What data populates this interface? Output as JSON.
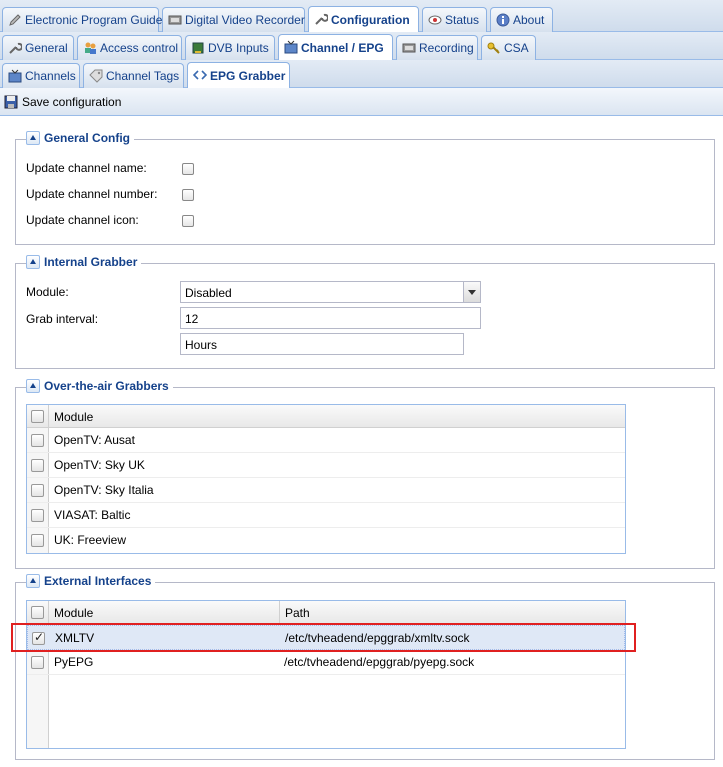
{
  "tabs_main": [
    {
      "label": "Electronic Program Guide",
      "icon": "pencil-icon"
    },
    {
      "label": "Digital Video Recorder",
      "icon": "film-icon"
    },
    {
      "label": "Configuration",
      "icon": "wrench-icon"
    },
    {
      "label": "Status",
      "icon": "eye-icon"
    },
    {
      "label": "About",
      "icon": "info-icon"
    }
  ],
  "tabs_config": [
    {
      "label": "General",
      "icon": "wrench-icon"
    },
    {
      "label": "Access control",
      "icon": "users-icon"
    },
    {
      "label": "DVB Inputs",
      "icon": "card-icon"
    },
    {
      "label": "Channel / EPG",
      "icon": "tv-icon"
    },
    {
      "label": "Recording",
      "icon": "film-icon"
    },
    {
      "label": "CSA",
      "icon": "key-icon"
    }
  ],
  "tabs_channel": [
    {
      "label": "Channels",
      "icon": "tv-icon"
    },
    {
      "label": "Channel Tags",
      "icon": "tag-icon"
    },
    {
      "label": "EPG Grabber",
      "icon": "code-icon"
    }
  ],
  "toolbar": {
    "save_label": "Save configuration"
  },
  "general": {
    "legend": "General Config",
    "update_name": "Update channel name:",
    "update_number": "Update channel number:",
    "update_icon": "Update channel icon:"
  },
  "internal": {
    "legend": "Internal Grabber",
    "module_label": "Module:",
    "module_value": "Disabled",
    "interval_label": "Grab interval:",
    "interval_value": "12",
    "interval_unit": "Hours"
  },
  "ota": {
    "legend": "Over-the-air Grabbers",
    "col_module": "Module",
    "rows": [
      "OpenTV: Ausat",
      "OpenTV: Sky UK",
      "OpenTV: Sky Italia",
      "VIASAT: Baltic",
      "UK: Freeview"
    ]
  },
  "external": {
    "legend": "External Interfaces",
    "col_module": "Module",
    "col_path": "Path",
    "rows": [
      {
        "module": "XMLTV",
        "path": "/etc/tvheadend/epggrab/xmltv.sock",
        "checked": true
      },
      {
        "module": "PyEPG",
        "path": "/etc/tvheadend/epggrab/pyepg.sock",
        "checked": false
      }
    ]
  }
}
